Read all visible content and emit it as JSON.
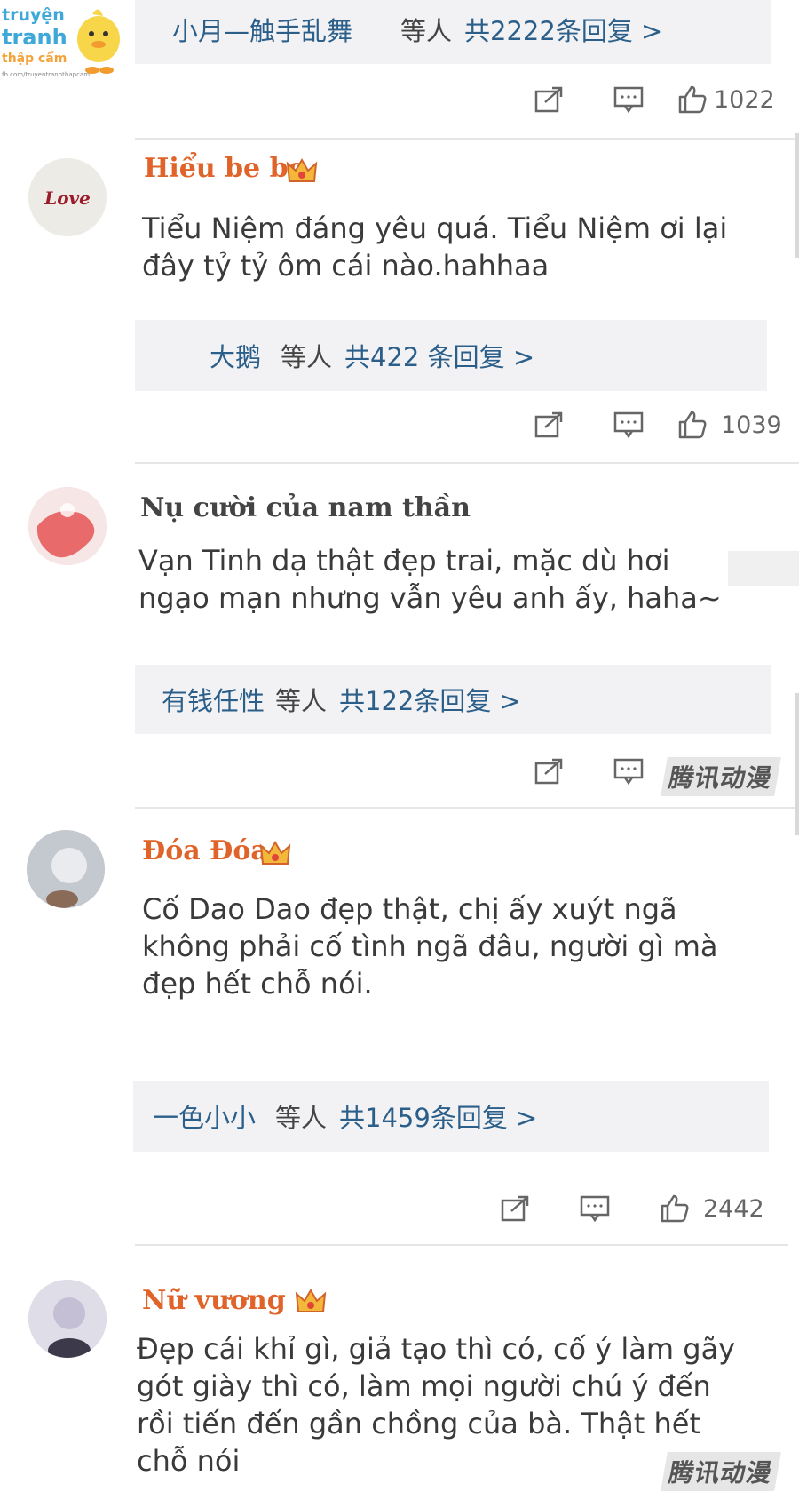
{
  "logo": {
    "line1": "truyện",
    "line2": "tranh",
    "line3": "thập cẩm",
    "url": "fb.com/truyentranhthapcam"
  },
  "threads": [
    {
      "reply": {
        "who": "小月—触手乱舞",
        "etc": "等人",
        "count": "共2222条回复 >"
      },
      "likes": "1022"
    },
    {
      "user": "Hiểu be be",
      "comment": "Tiểu Niệm đáng yêu quá. Tiểu Niệm ơi lại\nđây tỷ tỷ ôm cái nào.hahhaa",
      "reply": {
        "who": "大鹅",
        "etc": "等人",
        "count": "共422 条回复 >"
      },
      "likes": "1039"
    },
    {
      "user": "Nụ cười của nam thần",
      "comment": "Vạn Tinh dạ thật đẹp trai, mặc dù hơi\nngạo mạn  nhưng vẫn yêu anh ấy, haha~",
      "reply": {
        "who": "有钱任性",
        "etc": "等人",
        "count": "共122条回复 >"
      },
      "watermark": "腾讯动漫"
    },
    {
      "user": "Đóa Đóa",
      "comment": "Cố Dao Dao đẹp thật, chị ấy xuýt ngã\nkhông phải cố tình ngã đâu, người gì mà\nđẹp hết chỗ nói.",
      "reply": {
        "who": "一色小小",
        "etc": "等人",
        "count": "共1459条回复 >"
      },
      "likes": "2442"
    },
    {
      "user": "Nữ vương",
      "comment": "Đẹp cái khỉ gì, giả tạo thì có, cố ý làm gãy\ngót giày thì có, làm mọi người chú ý đến\nrồi tiến đến gần chồng của bà. Thật hết\nchỗ nói",
      "watermark": "腾讯动漫"
    }
  ],
  "icons": [
    "share-icon",
    "comment-icon",
    "like-thumb-icon",
    "crown-badge-icon"
  ],
  "colors": {
    "username": "#e0642a",
    "reply_bg": "#f2f2f4",
    "reply_text": "#2b5f8a"
  }
}
